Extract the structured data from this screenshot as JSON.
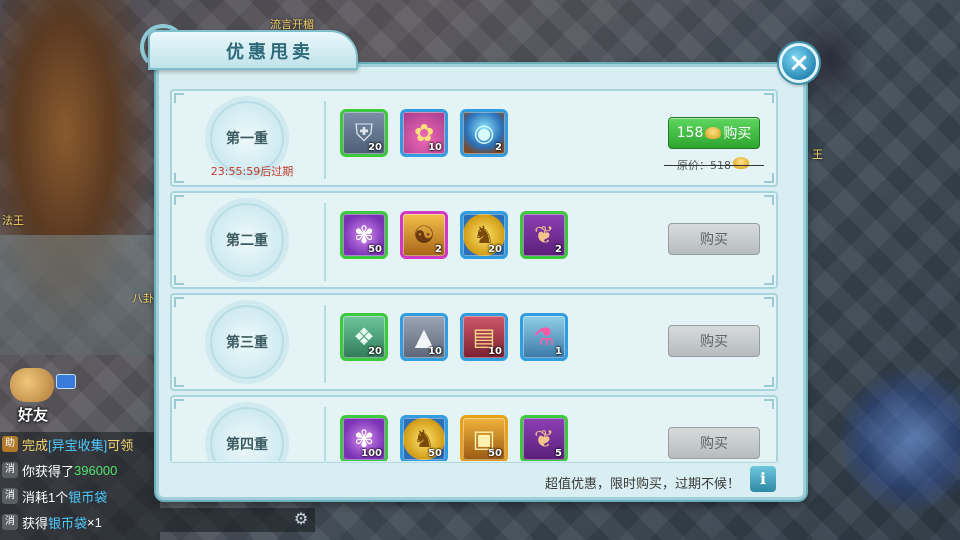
{
  "background": {
    "labels": [
      {
        "text": "流言开楣"
      },
      {
        "text": "法王"
      },
      {
        "text": "八卦"
      },
      {
        "text": "王"
      }
    ]
  },
  "chat": {
    "friend_label": "好友",
    "lines": [
      {
        "tag": "助",
        "parts": [
          "完成",
          "[异宝收集]",
          "可领"
        ]
      },
      {
        "tag": "消",
        "parts": [
          "你获得了",
          "396000"
        ]
      },
      {
        "tag": "消",
        "parts": [
          "消耗1个",
          "银币袋"
        ]
      },
      {
        "tag": "消",
        "parts": [
          "获得",
          "银币袋",
          "×1"
        ]
      }
    ]
  },
  "dialog": {
    "title": "优惠甩卖",
    "close_label": "×",
    "footer_text": "超值优惠，限时购买，过期不候！",
    "info_label": "i",
    "tiers": [
      {
        "name": "第一重",
        "timer": "23:55:59后过期",
        "buy_label": "购买",
        "price": "158",
        "original_price": "原价：518",
        "active": true,
        "items": [
          {
            "icon": "armor-icon",
            "count": "20",
            "rarity": "green"
          },
          {
            "icon": "pouch-icon",
            "count": "10",
            "rarity": "blue"
          },
          {
            "icon": "crystal-orb-icon",
            "count": "2",
            "rarity": "blue"
          }
        ]
      },
      {
        "name": "第二重",
        "buy_label": "购买",
        "active": false,
        "items": [
          {
            "icon": "paw-orb-icon",
            "count": "50",
            "rarity": "green"
          },
          {
            "icon": "golden-scroll-icon",
            "count": "2",
            "rarity": "purple"
          },
          {
            "icon": "horse-coin-icon",
            "count": "20",
            "rarity": "blue"
          },
          {
            "icon": "ginseng-icon",
            "count": "2",
            "rarity": "green"
          }
        ]
      },
      {
        "name": "第三重",
        "buy_label": "购买",
        "active": false,
        "items": [
          {
            "icon": "jade-token-icon",
            "count": "20",
            "rarity": "green"
          },
          {
            "icon": "silver-ingot-icon",
            "count": "10",
            "rarity": "blue"
          },
          {
            "icon": "book-icon",
            "count": "10",
            "rarity": "blue"
          },
          {
            "icon": "potion-icon",
            "count": "1",
            "rarity": "blue"
          }
        ]
      },
      {
        "name": "第四重",
        "buy_label": "购买",
        "active": false,
        "items": [
          {
            "icon": "paw-orb-icon",
            "count": "100",
            "rarity": "green"
          },
          {
            "icon": "horse-coin-icon",
            "count": "50",
            "rarity": "blue"
          },
          {
            "icon": "treasure-chest-icon",
            "count": "50",
            "rarity": "gold"
          },
          {
            "icon": "ginseng-icon",
            "count": "5",
            "rarity": "green"
          }
        ]
      }
    ]
  },
  "colors": {
    "panel": "#d9eef2",
    "buy_active": "#2ea52e",
    "buy_disabled": "#b6bcbe",
    "timer": "#c0392b"
  }
}
